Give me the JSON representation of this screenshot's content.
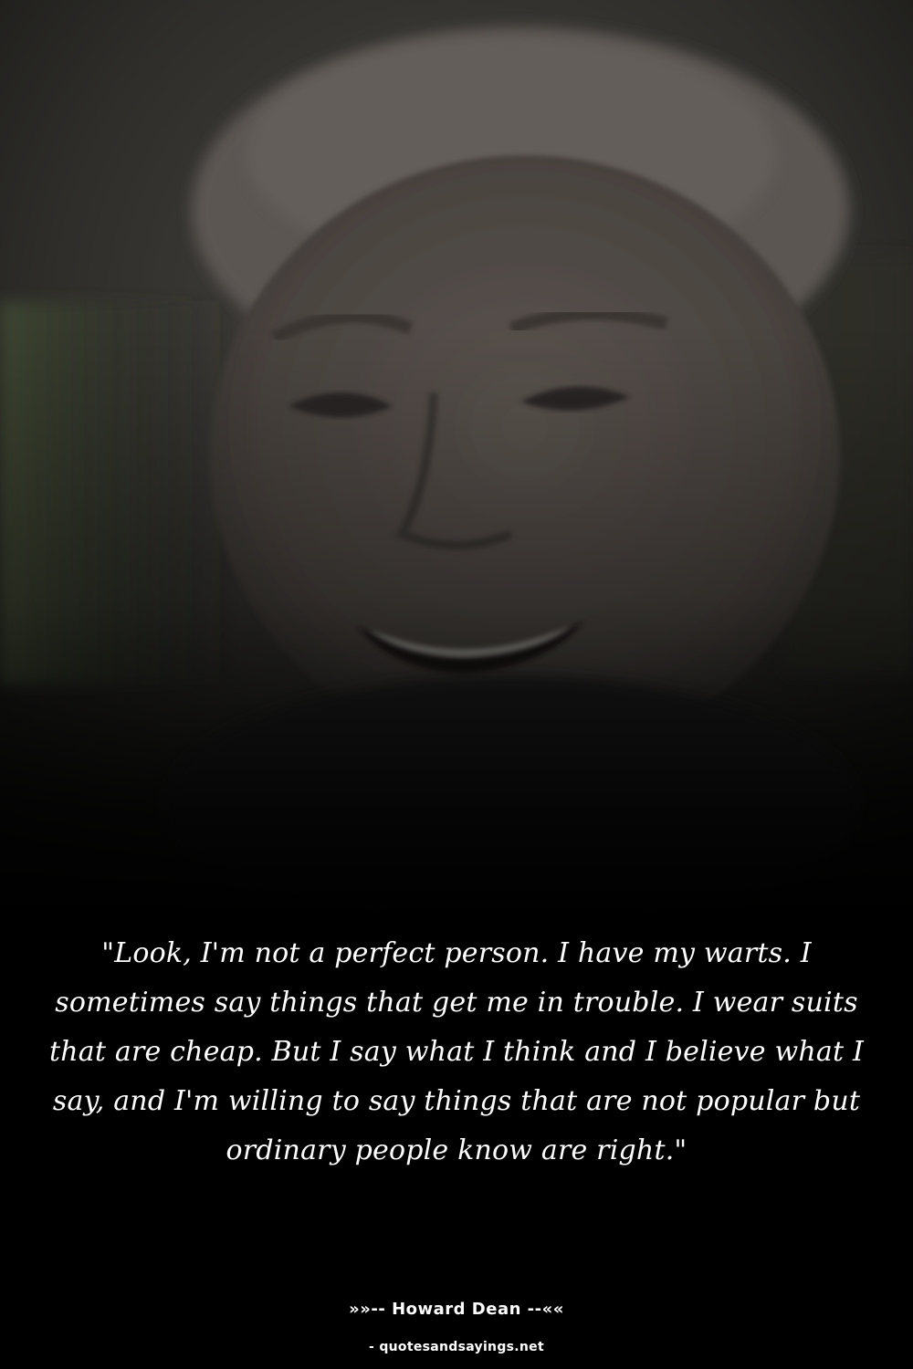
{
  "quote": {
    "text": "\"Look, I'm not a perfect person. I have my warts. I sometimes say things that get me in trouble. I wear suits that are cheap. But I say what I think and I believe what I say, and I'm willing to say things that are not popular but ordinary people know are right.\""
  },
  "author": {
    "label": "»»-- Howard Dean --««"
  },
  "source": {
    "label": "- quotesandsayings.net"
  },
  "colors": {
    "background": "#000000",
    "text": "#ffffff"
  }
}
